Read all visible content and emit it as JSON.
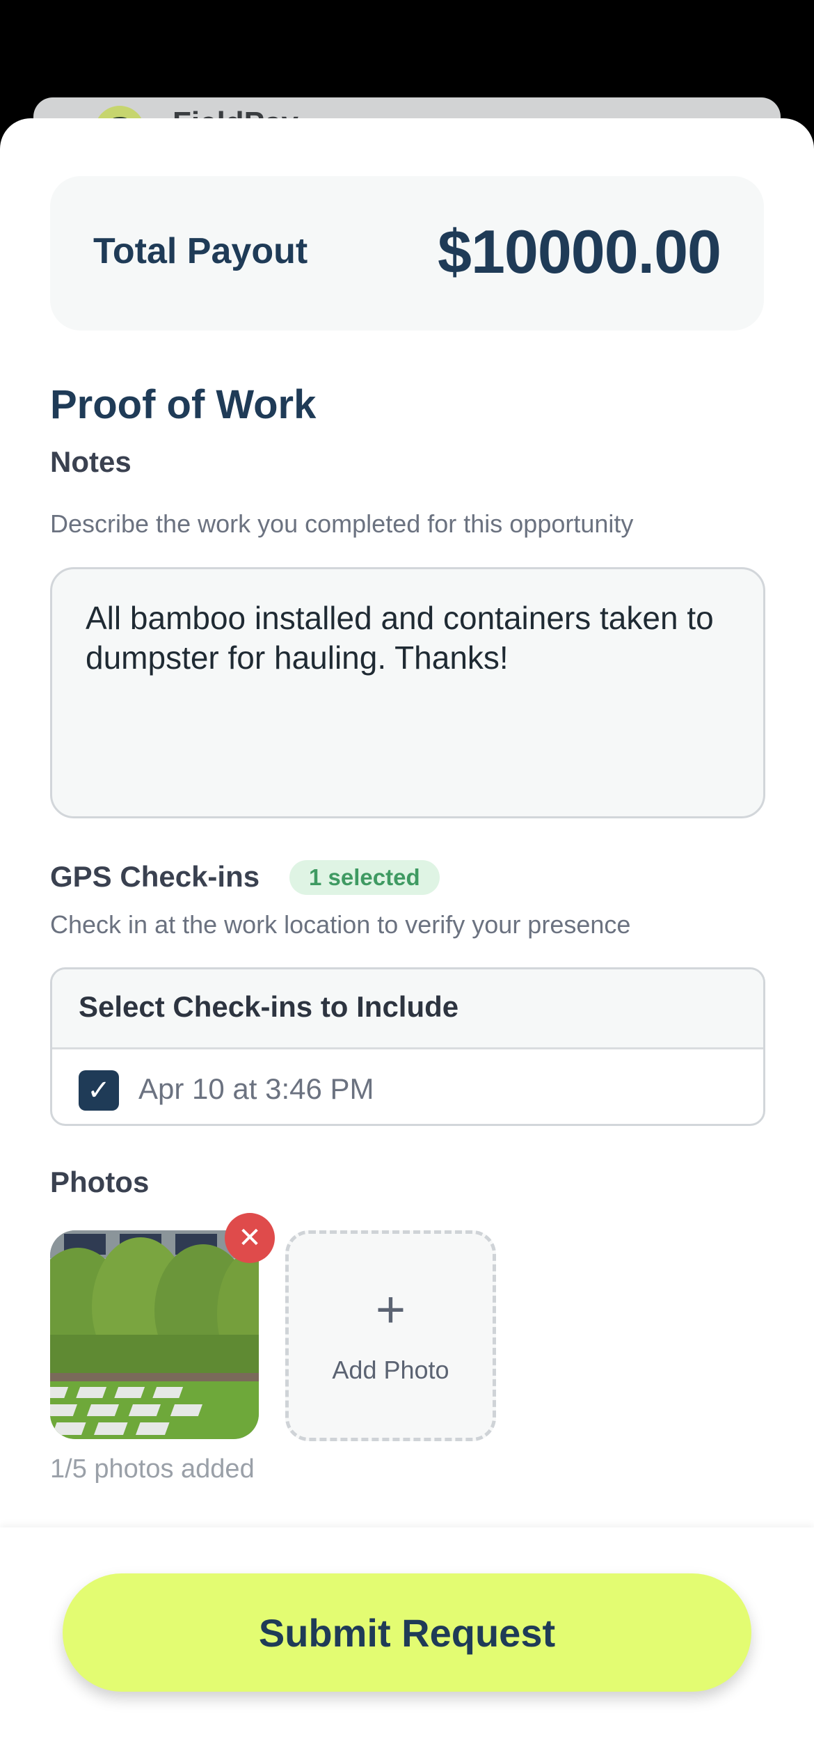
{
  "app": {
    "name": "FieldPay"
  },
  "payout": {
    "label": "Total Payout",
    "value": "$10000.00"
  },
  "proof": {
    "title": "Proof of Work",
    "notes_label": "Notes",
    "notes_description": "Describe the work you completed for this opportunity",
    "notes_value": "All bamboo installed and containers taken to dumpster for hauling. Thanks!"
  },
  "gps": {
    "label": "GPS Check-ins",
    "badge": "1 selected",
    "description": "Check in at the work location to verify your presence",
    "list_header": "Select Check-ins to Include",
    "items": [
      {
        "label": "Apr 10 at 3:46 PM",
        "checked": true
      }
    ]
  },
  "photos": {
    "label": "Photos",
    "add_label": "Add Photo",
    "count_text": "1/5 photos added",
    "remove_icon": "close-icon",
    "add_icon": "plus-icon"
  },
  "footer": {
    "submit_label": "Submit Request"
  },
  "colors": {
    "primary": "#1f3b57",
    "accent": "#e3fc72",
    "danger": "#df4b4b",
    "success": "#3f9a62"
  }
}
